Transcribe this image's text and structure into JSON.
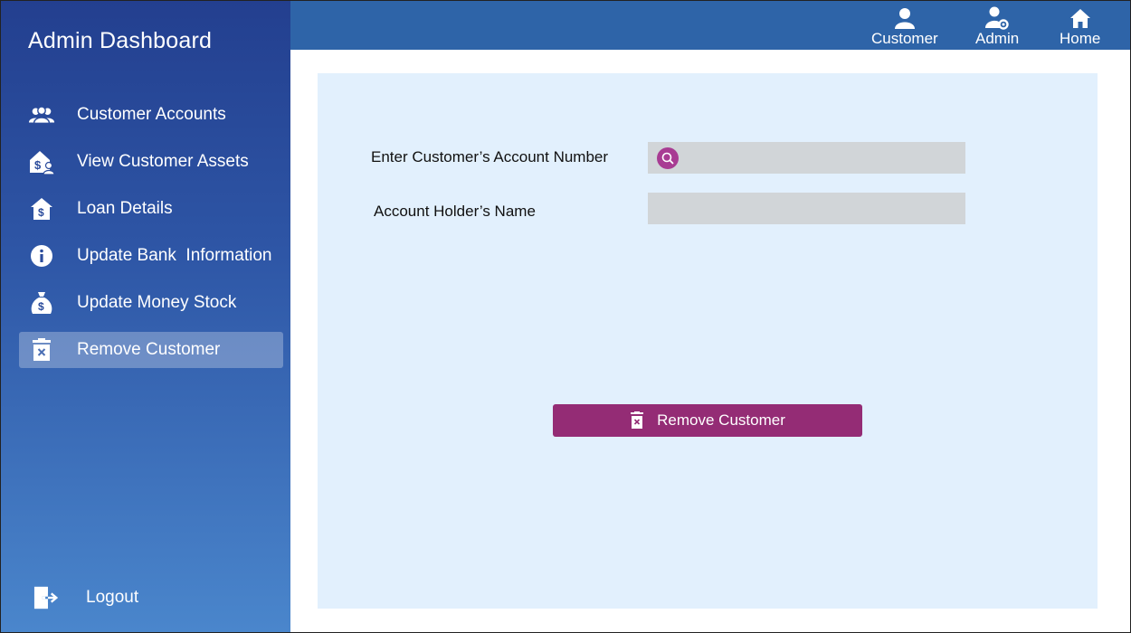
{
  "sidebar": {
    "title": "Admin Dashboard",
    "items": [
      {
        "label": "Customer Accounts",
        "icon": "users-icon"
      },
      {
        "label": "View Customer Assets",
        "icon": "money-house-user-icon"
      },
      {
        "label": "Loan Details",
        "icon": "house-dollar-icon"
      },
      {
        "label": "Update Bank  Information",
        "icon": "info-icon"
      },
      {
        "label": "Update Money Stock",
        "icon": "money-bag-icon"
      },
      {
        "label": "Remove Customer",
        "icon": "trash-x-icon",
        "active": true
      }
    ],
    "logout_label": "Logout"
  },
  "topbar": {
    "customer_label": "Customer",
    "admin_label": "Admin",
    "home_label": "Home"
  },
  "form": {
    "account_number_label": "Enter Customer’s Account Number",
    "account_number_value": "",
    "holder_name_label": "Account Holder’s Name",
    "holder_name_value": "",
    "remove_button_label": "Remove Customer"
  },
  "colors": {
    "sidebar_top": "#233f8f",
    "sidebar_bottom": "#4a86cc",
    "topbar": "#2e64a8",
    "panel": "#e2f0fd",
    "field": "#d1d5d8",
    "accent": "#942c75"
  }
}
